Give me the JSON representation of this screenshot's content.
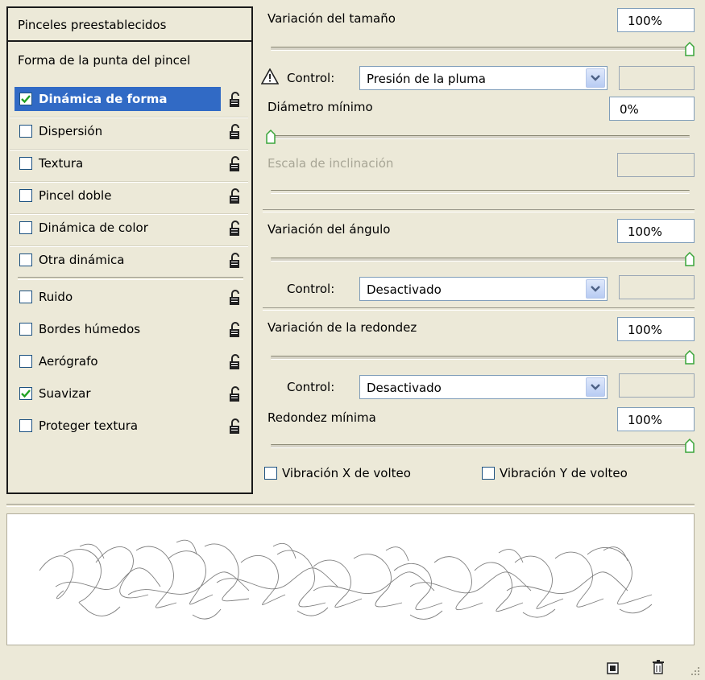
{
  "left_panel": {
    "presets_label": "Pinceles preestablecidos",
    "tip_shape_label": "Forma de la punta del pincel",
    "items": [
      {
        "label": "Dinámica de forma",
        "checked": true,
        "selected": true
      },
      {
        "label": "Dispersión",
        "checked": false
      },
      {
        "label": "Textura",
        "checked": false
      },
      {
        "label": "Pincel doble",
        "checked": false
      },
      {
        "label": "Dinámica de color",
        "checked": false
      },
      {
        "label": "Otra dinámica",
        "checked": false
      },
      {
        "label": "Ruido",
        "checked": false
      },
      {
        "label": "Bordes húmedos",
        "checked": false
      },
      {
        "label": "Aerógrafo",
        "checked": false
      },
      {
        "label": "Suavizar",
        "checked": true
      },
      {
        "label": "Proteger textura",
        "checked": false
      }
    ]
  },
  "settings": {
    "size_jitter": {
      "label": "Variación del tamaño",
      "value": "100%",
      "slider_fraction": 1.0
    },
    "size_control": {
      "label": "Control:",
      "value": "Presión de la pluma",
      "warning_icon": "warning-icon"
    },
    "min_diameter": {
      "label": "Diámetro mínimo",
      "value": "0%",
      "slider_fraction": 0.0
    },
    "tilt_scale": {
      "label": "Escala de inclinación",
      "disabled": true
    },
    "angle_jitter": {
      "label": "Variación del ángulo",
      "value": "100%",
      "slider_fraction": 1.0
    },
    "angle_control": {
      "label": "Control:",
      "value": "Desactivado"
    },
    "roundness_jitter": {
      "label": "Variación de la redondez",
      "value": "100%",
      "slider_fraction": 1.0
    },
    "roundness_control": {
      "label": "Control:",
      "value": "Desactivado"
    },
    "min_roundness": {
      "label": "Redondez mínima",
      "value": "100%",
      "slider_fraction": 1.0
    },
    "flip_x": {
      "label": "Vibración X de volteo",
      "checked": false
    },
    "flip_y": {
      "label": "Vibración Y de volteo",
      "checked": false
    }
  },
  "colors": {
    "selection": "#316ac5",
    "slider_thumb_accent": "#3aa53a",
    "panel_bg": "#ece9d8"
  },
  "bottom_bar": {
    "new_icon": "new-brush-icon",
    "delete_icon": "trash-icon",
    "grip_icon": "resize-grip-icon"
  }
}
